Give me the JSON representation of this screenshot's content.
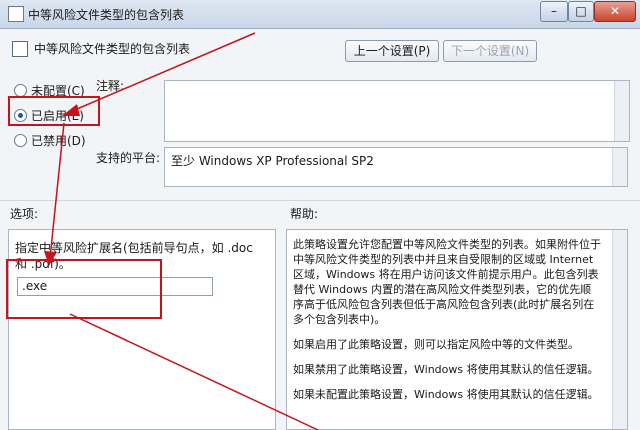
{
  "window": {
    "title": "中等风险文件类型的包含列表",
    "minimize": "–",
    "maximize": "□",
    "close": "✕"
  },
  "header": {
    "policy_name": "中等风险文件类型的包含列表",
    "prev_button": "上一个设置(P)",
    "next_button": "下一个设置(N)"
  },
  "state": {
    "options": [
      {
        "label": "未配置(C)",
        "selected": false
      },
      {
        "label": "已启用(E)",
        "selected": true
      },
      {
        "label": "已禁用(D)",
        "selected": false
      }
    ]
  },
  "comment": {
    "label": "注释:",
    "value": ""
  },
  "platform": {
    "label": "支持的平台:",
    "value": "至少 Windows XP Professional SP2"
  },
  "options_section": {
    "label": "选项:",
    "description_line1": "指定中等风险扩展名(包括前导句点，如 .doc",
    "description_line2": "和 .pdf)。",
    "extension_value": ".exe"
  },
  "help_section": {
    "label": "帮助:",
    "paragraphs": [
      "此策略设置允许您配置中等风险文件类型的列表。如果附件位于中等风险文件类型的列表中并且来自受限制的区域或 Internet 区域，Windows 将在用户访问该文件前提示用户。此包含列表替代 Windows 内置的潜在高风险文件类型列表，它的优先顺序高于低风险包含列表但低于高风险包含列表(此时扩展名列在多个包含列表中)。",
      "如果启用了此策略设置，则可以指定风险中等的文件类型。",
      "如果禁用了此策略设置，Windows 将使用其默认的信任逻辑。",
      "如果未配置此策略设置，Windows 将使用其默认的信任逻辑。"
    ]
  },
  "colors": {
    "highlight": "#c4151c",
    "titlebar": "#c9d7e8",
    "selected_radio": "#1b5aa8"
  }
}
